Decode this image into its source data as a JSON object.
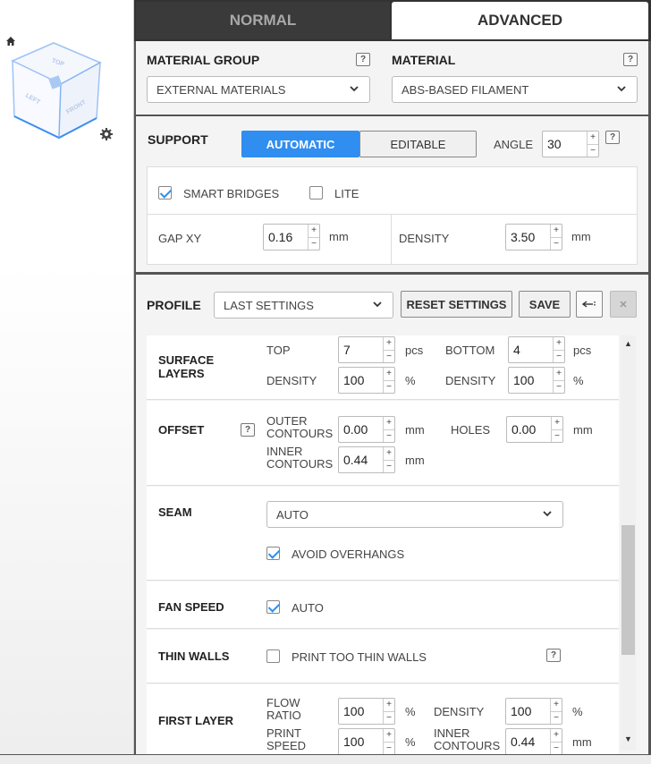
{
  "tabs": {
    "normal": "NORMAL",
    "advanced": "ADVANCED"
  },
  "viewcube": {
    "top": "TOP",
    "left": "LEFT",
    "front": "FRONT"
  },
  "material": {
    "group_label": "MATERIAL GROUP",
    "group_value": "EXTERNAL MATERIALS",
    "material_label": "MATERIAL",
    "material_value": "ABS-BASED FILAMENT",
    "help": "?"
  },
  "support": {
    "label": "SUPPORT",
    "automatic": "AUTOMATIC",
    "editable": "EDITABLE",
    "angle_label": "ANGLE",
    "angle_value": "30",
    "smart_bridges": "SMART BRIDGES",
    "lite": "LITE",
    "gap_xy_label": "GAP XY",
    "gap_xy_value": "0.16",
    "gap_xy_unit": "mm",
    "density_label": "DENSITY",
    "density_value": "3.50",
    "density_unit": "mm",
    "help": "?"
  },
  "profile": {
    "label": "PROFILE",
    "value": "LAST SETTINGS",
    "reset": "RESET SETTINGS",
    "save": "SAVE"
  },
  "settings": {
    "surface_layers": {
      "label": "SURFACE LAYERS",
      "top_label": "TOP",
      "top_value": "7",
      "top_unit": "pcs",
      "bottom_label": "BOTTOM",
      "bottom_value": "4",
      "bottom_unit": "pcs",
      "density1_label": "DENSITY",
      "density1_value": "100",
      "density1_unit": "%",
      "density2_label": "DENSITY",
      "density2_value": "100",
      "density2_unit": "%"
    },
    "offset": {
      "label": "OFFSET",
      "outer_label": "OUTER CONTOURS",
      "outer_value": "0.00",
      "outer_unit": "mm",
      "holes_label": "HOLES",
      "holes_value": "0.00",
      "holes_unit": "mm",
      "inner_label": "INNER CONTOURS",
      "inner_value": "0.44",
      "inner_unit": "mm",
      "help": "?"
    },
    "seam": {
      "label": "SEAM",
      "value": "AUTO",
      "avoid_overhangs": "AVOID OVERHANGS"
    },
    "fan_speed": {
      "label": "FAN SPEED",
      "auto": "AUTO"
    },
    "thin_walls": {
      "label": "THIN WALLS",
      "print_thin": "PRINT TOO THIN WALLS",
      "help": "?"
    },
    "first_layer": {
      "label": "FIRST LAYER",
      "flow_label": "FLOW RATIO",
      "flow_value": "100",
      "flow_unit": "%",
      "density_label": "DENSITY",
      "density_value": "100",
      "density_unit": "%",
      "speed_label": "PRINT SPEED",
      "speed_value": "100",
      "speed_unit": "%",
      "inner_label": "INNER CONTOURS",
      "inner_value": "0.44",
      "inner_unit": "mm"
    }
  },
  "spin_up": "+",
  "spin_down": "−"
}
